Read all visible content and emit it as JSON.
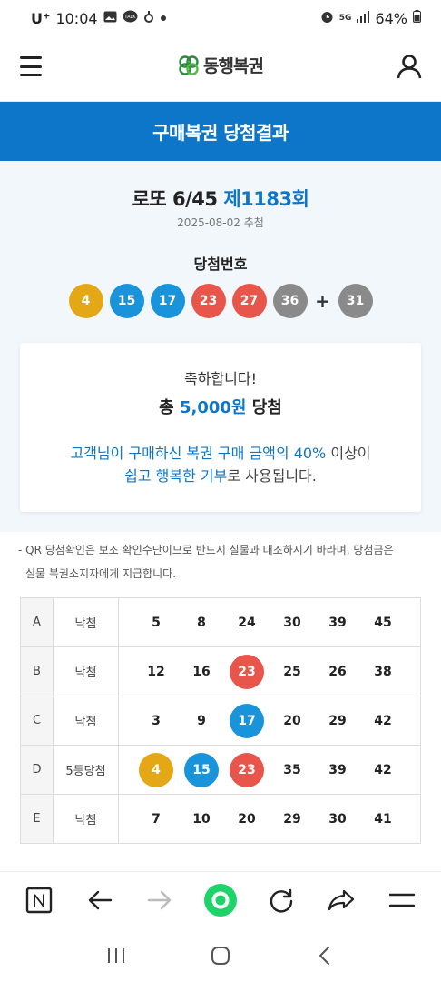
{
  "status_bar": {
    "carrier": "U⁺",
    "time": "10:04",
    "battery": "64%",
    "network": "5G"
  },
  "header": {
    "logo_text": "동행복권"
  },
  "banner": {
    "title": "구매복권 당첨결과"
  },
  "draw": {
    "game": "로또 6/45",
    "round": "제1183회",
    "date": "2025-08-02 추첨",
    "winning_label": "당첨번호",
    "numbers": [
      {
        "value": "4",
        "color": "#e4a816"
      },
      {
        "value": "15",
        "color": "#1993d9"
      },
      {
        "value": "17",
        "color": "#1993d9"
      },
      {
        "value": "23",
        "color": "#e8564b"
      },
      {
        "value": "27",
        "color": "#e8564b"
      },
      {
        "value": "36",
        "color": "#8a8a8a"
      }
    ],
    "plus": "+",
    "bonus": {
      "value": "31",
      "color": "#8a8a8a"
    }
  },
  "prize_card": {
    "congrats": "축하합니다!",
    "total_prefix": "총",
    "total_amount": "5,000원",
    "total_suffix": "당첨",
    "donation_part1": "고객님이 구매하신 복권 구매 금액의 40%",
    "donation_part2": "이상이",
    "donation_part3": "쉽고 행복한 기부",
    "donation_part4": "로 사용됩니다."
  },
  "notice": {
    "line1": "- QR 당첨확인은 보조 확인수단이므로 반드시 실물과 대조하시기 바라며, 당첨금은",
    "line2": "실물 복권소지자에게 지급합니다."
  },
  "tickets": [
    {
      "key": "A",
      "result": "낙첨",
      "numbers": [
        "5",
        "8",
        "24",
        "30",
        "39",
        "45"
      ]
    },
    {
      "key": "B",
      "result": "낙첨",
      "numbers": [
        "12",
        "16",
        "23",
        "25",
        "26",
        "38"
      ]
    },
    {
      "key": "C",
      "result": "낙첨",
      "numbers": [
        "3",
        "9",
        "17",
        "20",
        "29",
        "42"
      ]
    },
    {
      "key": "D",
      "result": "5등당첨",
      "numbers": [
        "4",
        "15",
        "23",
        "35",
        "39",
        "42"
      ]
    },
    {
      "key": "E",
      "result": "낙첨",
      "numbers": [
        "7",
        "10",
        "20",
        "29",
        "30",
        "41"
      ]
    }
  ],
  "colors": {
    "brand_blue": "#0e76c8",
    "ball_yellow": "#e4a816",
    "ball_blue": "#1993d9",
    "ball_red": "#e8564b",
    "ball_gray": "#8a8a8a",
    "home_green": "#1fd36b"
  },
  "browser_toolbar": [
    "n-tab-icon",
    "back-arrow-icon",
    "forward-arrow-icon",
    "home-icon",
    "refresh-icon",
    "share-icon",
    "menu-icon"
  ],
  "system_nav": [
    "recent-apps-icon",
    "home-icon",
    "back-icon"
  ]
}
